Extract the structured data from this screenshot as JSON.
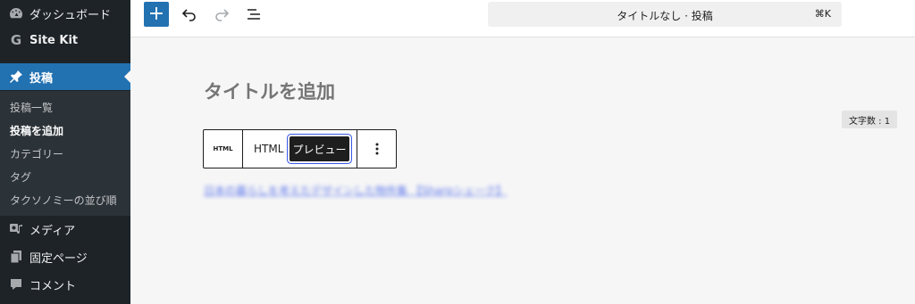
{
  "sidebar": {
    "items": [
      {
        "label": "ダッシュボード",
        "icon": "dashboard-icon"
      },
      {
        "label": "Site Kit",
        "icon": "google-g-icon"
      },
      {
        "label": "投稿",
        "icon": "pushpin-icon",
        "active": true
      },
      {
        "label": "メディア",
        "icon": "media-icon"
      },
      {
        "label": "固定ページ",
        "icon": "page-icon"
      },
      {
        "label": "コメント",
        "icon": "comment-icon"
      }
    ],
    "submenu": [
      {
        "label": "投稿一覧"
      },
      {
        "label": "投稿を追加",
        "current": true
      },
      {
        "label": "カテゴリー"
      },
      {
        "label": "タグ"
      },
      {
        "label": "タクソノミーの並び順"
      }
    ]
  },
  "toolbar": {
    "add_label": "+",
    "command_title": "タイトルなし · 投稿",
    "shortcut": "⌘K"
  },
  "editor": {
    "title_placeholder": "タイトルを追加",
    "word_count": "文字数 : 1",
    "block_toolbar": {
      "icon_text": "HTML",
      "html_label": "HTML",
      "preview_label": "プレビュー"
    },
    "blurred_link_text": "日本の暮らしを考えたデザインした物件集 【Sharpシェーク】"
  },
  "colors": {
    "sidebar_bg": "#1d2327",
    "submenu_bg": "#2c3338",
    "accent": "#2271b1",
    "canvas_bg": "#f6f6f6"
  }
}
